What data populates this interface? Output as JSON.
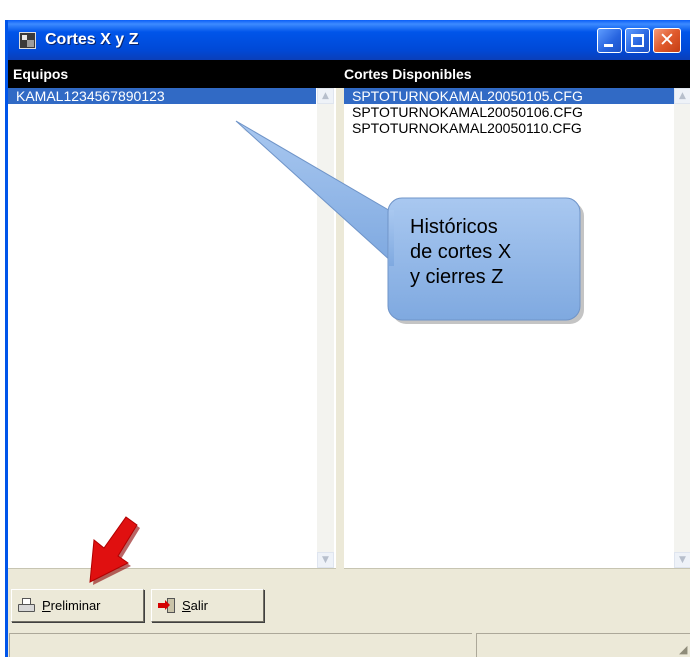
{
  "window": {
    "title": "Cortes X y Z"
  },
  "columns": {
    "equipos": "Equipos",
    "cortes": "Cortes Disponibles"
  },
  "equipos": [
    "KAMAL1234567890123"
  ],
  "cortes": [
    "SPTOTURNOKAMAL20050105.CFG",
    "SPTOTURNOKAMAL20050106.CFG",
    "SPTOTURNOKAMAL20050110.CFG"
  ],
  "buttons": {
    "preliminar": "Preliminar",
    "salir": "Salir"
  },
  "callout": {
    "lines": [
      "Históricos",
      "de cortes X",
      "y cierres Z"
    ]
  },
  "icons": {
    "app": "app-icon",
    "minimize": "minimize-icon",
    "maximize": "maximize-icon",
    "close": "close-icon",
    "printer": "printer-icon",
    "exit": "exit-icon",
    "pointer": "red-arrow-icon"
  },
  "colors": {
    "titlebar": "#0055ea",
    "selection": "#316ac5",
    "callout": "#8db3e2",
    "pointer": "#e01010"
  }
}
